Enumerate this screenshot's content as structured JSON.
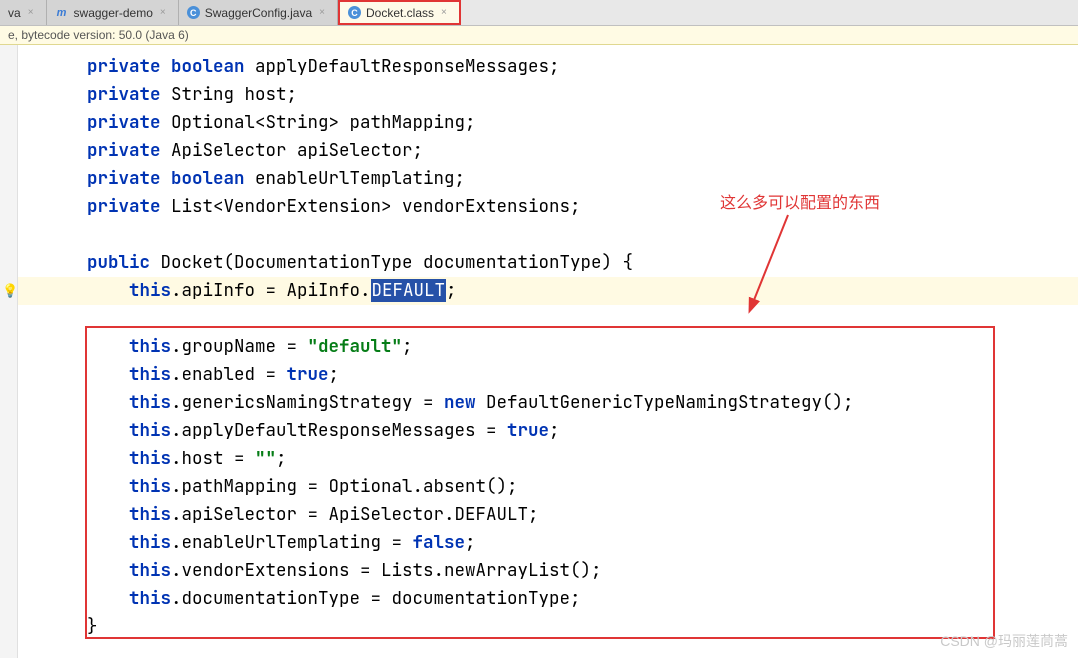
{
  "tabs": [
    {
      "icon": "",
      "label": "va"
    },
    {
      "icon": "m",
      "label": "swagger-demo"
    },
    {
      "icon": "c",
      "label": "SwaggerConfig.java"
    },
    {
      "icon": "c2",
      "label": "Docket.class"
    }
  ],
  "info_bar": "e, bytecode version: 50.0 (Java 6)",
  "annotation_text": "这么多可以配置的东西",
  "watermark": "CSDN @玛丽莲茼蒿",
  "code": {
    "l1_kw": "private",
    "l1_kw2": "boolean",
    "l1_rest": " applyDefaultResponseMessages;",
    "l2_kw": "private",
    "l2_rest": " String host;",
    "l3_kw": "private",
    "l3_rest": " Optional<String> pathMapping;",
    "l4_kw": "private",
    "l4_rest": " ApiSelector apiSelector;",
    "l5_kw": "private",
    "l5_kw2": "boolean",
    "l5_rest": " enableUrlTemplating;",
    "l6_kw": "private",
    "l6_rest": " List<VendorExtension> vendorExtensions;",
    "l8_kw": "public",
    "l8_rest": " Docket(DocumentationType documentationType) {",
    "l9_kw": "this",
    "l9_a": ".apiInfo = ApiInfo.",
    "l9_sel": "DEFAULT",
    "l9_b": ";",
    "l10_kw": "this",
    "l10_a": ".groupName = ",
    "l10_str": "\"default\"",
    "l10_b": ";",
    "l11_kw": "this",
    "l11_a": ".enabled = ",
    "l11_kw2": "true",
    "l11_b": ";",
    "l12_kw": "this",
    "l12_a": ".genericsNamingStrategy = ",
    "l12_kw2": "new",
    "l12_b": " DefaultGenericTypeNamingStrategy();",
    "l13_kw": "this",
    "l13_a": ".applyDefaultResponseMessages = ",
    "l13_kw2": "true",
    "l13_b": ";",
    "l14_kw": "this",
    "l14_a": ".host = ",
    "l14_str": "\"\"",
    "l14_b": ";",
    "l15_kw": "this",
    "l15_a": ".pathMapping = Optional.absent();",
    "l16_kw": "this",
    "l16_a": ".apiSelector = ApiSelector.DEFAULT;",
    "l17_kw": "this",
    "l17_a": ".enableUrlTemplating = ",
    "l17_kw2": "false",
    "l17_b": ";",
    "l18_kw": "this",
    "l18_a": ".vendorExtensions = Lists.newArrayList();",
    "l19_kw": "this",
    "l19_a": ".documentationType = documentationType;",
    "l20": "}"
  }
}
